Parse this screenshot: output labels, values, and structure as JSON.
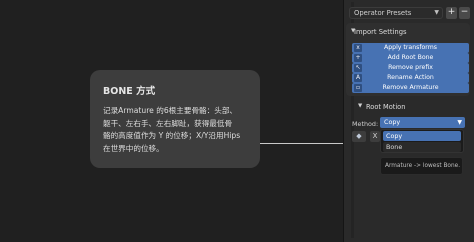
{
  "callout": {
    "title": "BONE 方式",
    "lines": [
      "记录Armature 的6根主要骨骼：头部、",
      "躯干、左右手、左右脚趾，获得最低骨",
      "骼的高度值作为 Y 的位移；X/Y沿用Hips",
      "在世界中的位移。"
    ]
  },
  "sidebar": {
    "presets": {
      "label": "Operator Presets",
      "add": "+",
      "remove": "−"
    },
    "import_settings": {
      "header": "Import Settings",
      "buttons": [
        {
          "icon": "x",
          "label": "Apply transforms"
        },
        {
          "icon": "+",
          "label": "Add Root Bone"
        },
        {
          "icon": "↖",
          "label": "Remove prefix"
        },
        {
          "icon": "A",
          "label": "Rename Action"
        },
        {
          "icon": "▫",
          "label": "Remove Armature"
        }
      ]
    },
    "root_motion": {
      "header": "Root Motion",
      "method_label": "Method:",
      "method_value": "Copy",
      "toggle_label": "X",
      "dropdown_options": [
        "Copy",
        "Bone"
      ],
      "tooltip": "Armature -> lowest Bone."
    }
  },
  "colors": {
    "accent": "#4772b3",
    "panel": "#2a2a2a",
    "callout": "#3d3d3d"
  }
}
